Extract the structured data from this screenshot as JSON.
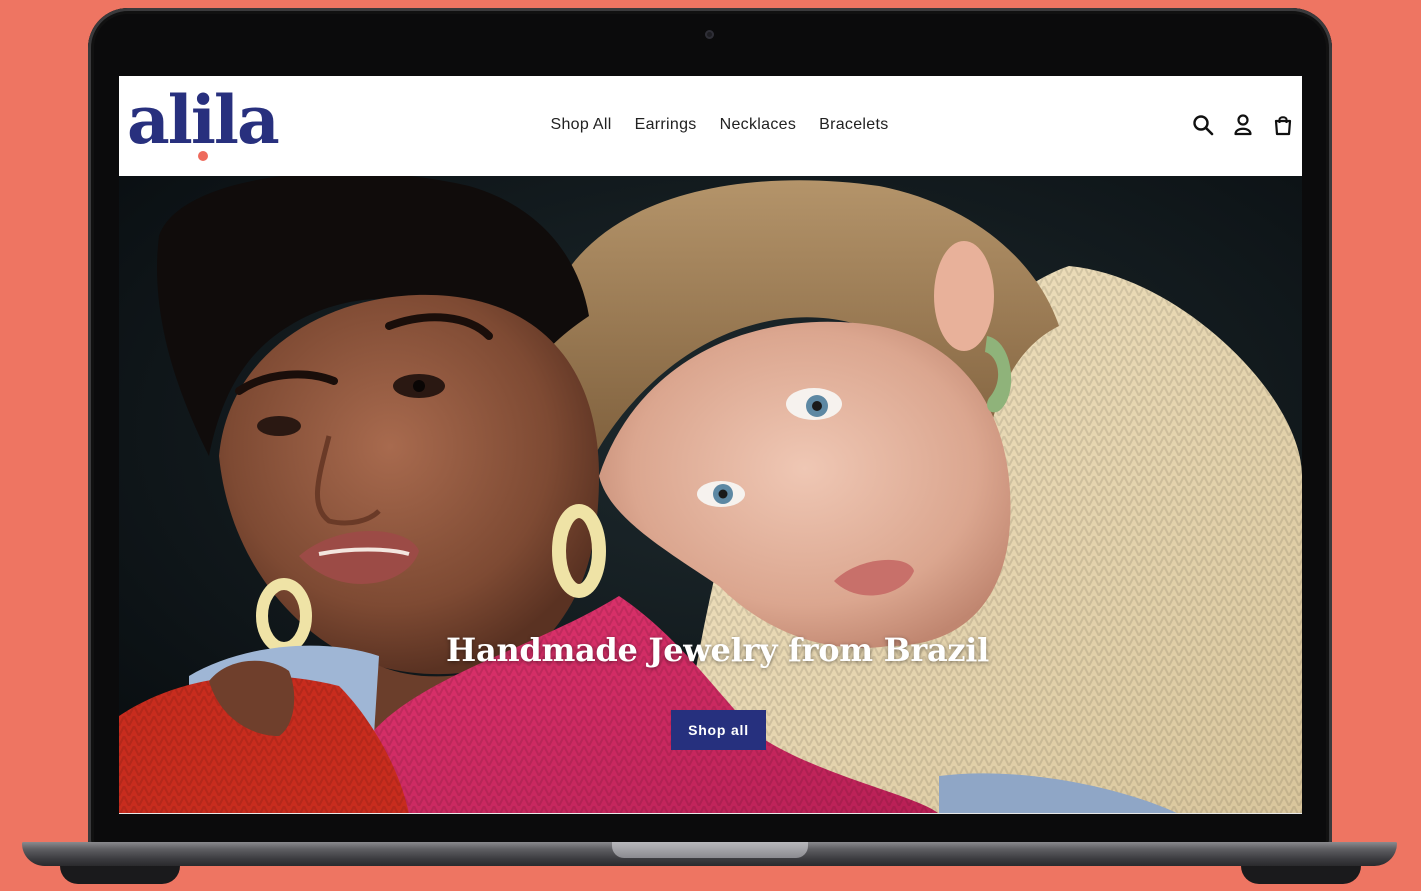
{
  "device": {
    "type": "laptop",
    "background_color": "#ee7562"
  },
  "header": {
    "logo_text": "alila",
    "logo_color": "#28307e",
    "logo_dot_color": "#ee6a5c",
    "nav": [
      {
        "label": "Shop All"
      },
      {
        "label": "Earrings"
      },
      {
        "label": "Necklaces"
      },
      {
        "label": "Bracelets"
      }
    ],
    "icons": [
      "search-icon",
      "account-icon",
      "cart-icon"
    ]
  },
  "hero": {
    "title": "Handmade Jewelry from Brazil",
    "button_label": "Shop all",
    "button_color": "#26307e"
  }
}
